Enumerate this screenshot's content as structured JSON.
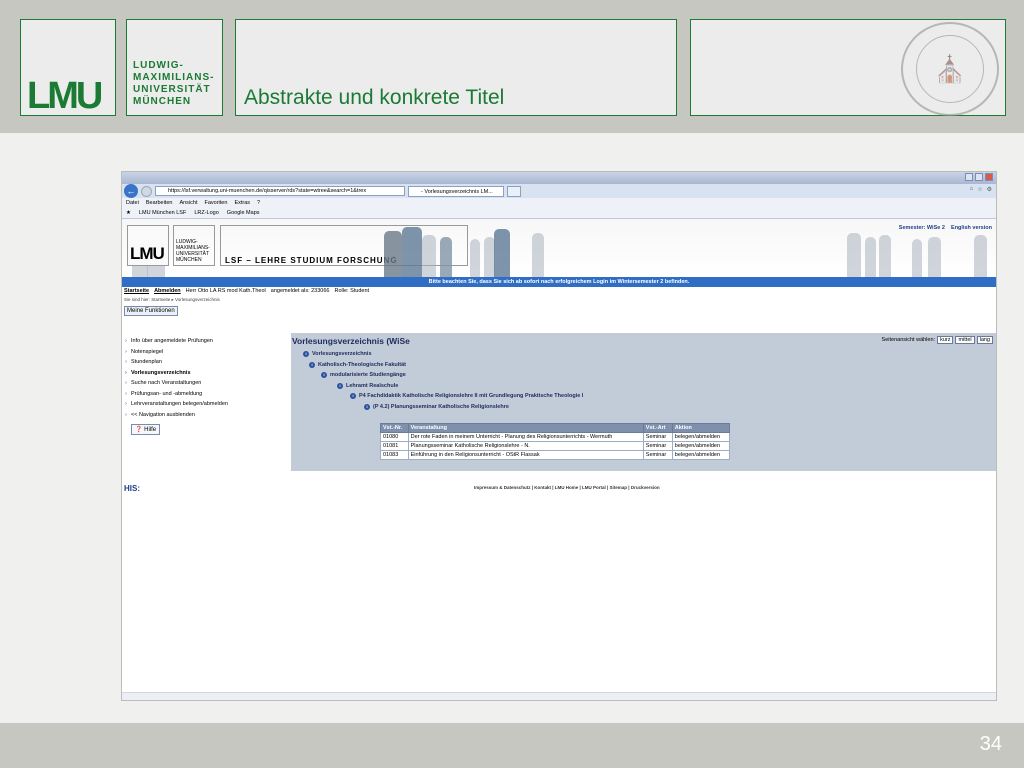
{
  "slide": {
    "title": "Abstrakte und konkrete Titel",
    "page_number": "34",
    "logo_text": "LMU",
    "university": [
      "LUDWIG-",
      "MAXIMILIANS-",
      "UNIVERSITÄT",
      "MÜNCHEN"
    ],
    "colors": {
      "green": "#1b7a33",
      "header_bg": "#c6c7c0"
    }
  },
  "browser": {
    "url": "https://lsf.verwaltung.uni-muenchen.de/qisserver/rds?state=wtree&search=1&trex",
    "tab_label": "- Vorlesungsverzeichnis LM...",
    "menu": [
      "Datei",
      "Bearbeiten",
      "Ansicht",
      "Favoriten",
      "Extras",
      "?"
    ],
    "favorites": [
      "LMU München LSF",
      "LRZ-Logo",
      "Google Maps"
    ]
  },
  "site": {
    "banner_logo": "LMU",
    "banner_uni": "LUDWIG- MAXIMILIANS- UNIVERSITÄT MÜNCHEN",
    "banner_title": "LSF – LEHRE STUDIUM FORSCHUNG",
    "semester_label": "Semester: WiSe 2",
    "english": "English version",
    "notice": "Bitte beachten Sie, dass Sie sich ab sofort nach erfolgreichem Login im Wintersemester 2 befinden.",
    "userline": [
      "Startseite",
      "Abmelden",
      "Herr Otto LA RS mod Kath.Theol",
      "angemeldet als: 233066",
      "Rolle: Student"
    ],
    "breadcrumb": "Sie sind hier: Startseite ▸ Vorlesungsverzeichnis",
    "my_functions": "Meine Funktionen",
    "side_items": [
      "Info über angemeldete Prüfungen",
      "Notenspiegel",
      "Stundenplan",
      "Vorlesungsverzeichnis",
      "Suche nach Veranstaltungen",
      "Prüfungsan- und -abmeldung",
      "Lehrveranstaltungen belegen/abmelden",
      "<< Navigation ausblenden"
    ],
    "help": "Hilfe",
    "his": "HIS:",
    "footer": "Impressum & Datenschutz | Kontakt | LMU Home | LMU Portal | Sitemap | Druckversion"
  },
  "panel": {
    "title": "Vorlesungsverzeichnis (WiSe",
    "view_label": "Seitenansicht wählen:",
    "views": [
      "kurz",
      "mittel",
      "lang"
    ],
    "tree": [
      "Vorlesungsverzeichnis",
      "Katholisch-Theologische Fakultät",
      "modularisierte Studiengänge",
      "Lehramt Realschule",
      "P4 Fachdidaktik Katholische Religionslehre II mit Grundlegung Praktische Theologie I",
      "(P 4.2) Planungsseminar Katholische Religionslehre"
    ],
    "columns": [
      "Vst.-Nr.",
      "Veranstaltung",
      "Vst.-Art",
      "Aktion"
    ],
    "rows": [
      [
        "01080",
        "Der rote Faden in meinem Unterricht - Planung des Religionsunterrichts  -  Wermuth",
        "Seminar",
        "belegen/abmelden"
      ],
      [
        "01081",
        "Planungsseminar Katholische Religionslehre  -  N.",
        "Seminar",
        "belegen/abmelden"
      ],
      [
        "01083",
        "Einführung in den Religionsunterricht  -  OStR Flassak",
        "Seminar",
        "belegen/abmelden"
      ]
    ]
  }
}
